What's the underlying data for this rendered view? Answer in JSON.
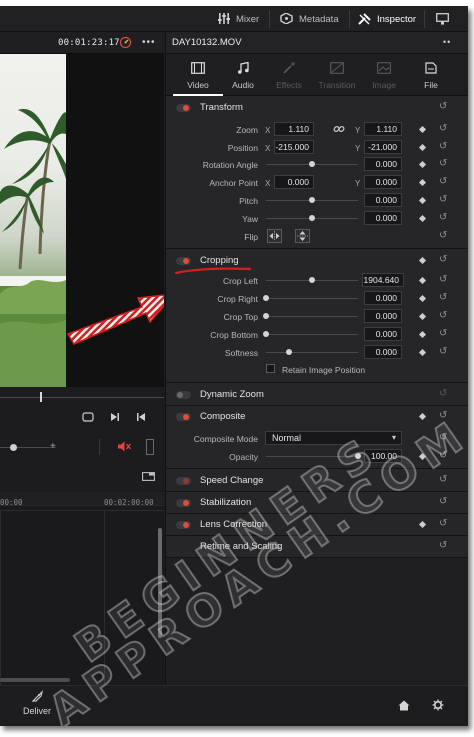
{
  "topbar": {
    "mixer_label": "Mixer",
    "metadata_label": "Metadata",
    "inspector_label": "Inspector"
  },
  "viewer": {
    "timecode": "00:01:23:17"
  },
  "inspector": {
    "clip_name": "DAY10132.MOV",
    "tabs": [
      {
        "label": "Video",
        "icon": "film-icon",
        "state": "active"
      },
      {
        "label": "Audio",
        "icon": "music-note-icon",
        "state": "normal"
      },
      {
        "label": "Effects",
        "icon": "magic-wand-icon",
        "state": "disabled"
      },
      {
        "label": "Transition",
        "icon": "transition-icon",
        "state": "disabled"
      },
      {
        "label": "Image",
        "icon": "image-icon",
        "state": "disabled"
      },
      {
        "label": "File",
        "icon": "file-icon",
        "state": "normal"
      }
    ],
    "transform": {
      "title": "Transform",
      "zoom_label": "Zoom",
      "zoom_x": "1.110",
      "zoom_y": "1.110",
      "position_label": "Position",
      "position_x": "-215.000",
      "position_y": "-21.000",
      "rotation_label": "Rotation Angle",
      "rotation": "0.000",
      "anchor_label": "Anchor Point",
      "anchor_x": "0.000",
      "anchor_y": "0.000",
      "pitch_label": "Pitch",
      "pitch": "0.000",
      "yaw_label": "Yaw",
      "yaw": "0.000",
      "flip_label": "Flip",
      "x_label": "X",
      "y_label": "Y"
    },
    "cropping": {
      "title": "Cropping",
      "crop_left_label": "Crop Left",
      "crop_left": "1904.640",
      "crop_right_label": "Crop Right",
      "crop_right": "0.000",
      "crop_top_label": "Crop Top",
      "crop_top": "0.000",
      "crop_bottom_label": "Crop Bottom",
      "crop_bottom": "0.000",
      "softness_label": "Softness",
      "softness": "0.000",
      "retain_label": "Retain Image Position"
    },
    "dynamic_zoom": {
      "title": "Dynamic Zoom"
    },
    "composite": {
      "title": "Composite",
      "mode_label": "Composite Mode",
      "mode_value": "Normal",
      "opacity_label": "Opacity",
      "opacity": "100.00"
    },
    "speed_change": {
      "title": "Speed Change"
    },
    "stabilization": {
      "title": "Stabilization"
    },
    "lens_correction": {
      "title": "Lens Correction"
    },
    "retime": {
      "title": "Retime and Scaling"
    }
  },
  "timeline": {
    "ruler_a": "00:00",
    "ruler_b": "00:02:00:00"
  },
  "bottom": {
    "deliver_label": "Deliver"
  },
  "watermark": {
    "line1": "BEGINNERS",
    "line2": "APPROACH.COM"
  },
  "colors": {
    "accent_red": "#e24a3c",
    "panel": "#262629",
    "annotation_arrow": "#d21f1f"
  }
}
